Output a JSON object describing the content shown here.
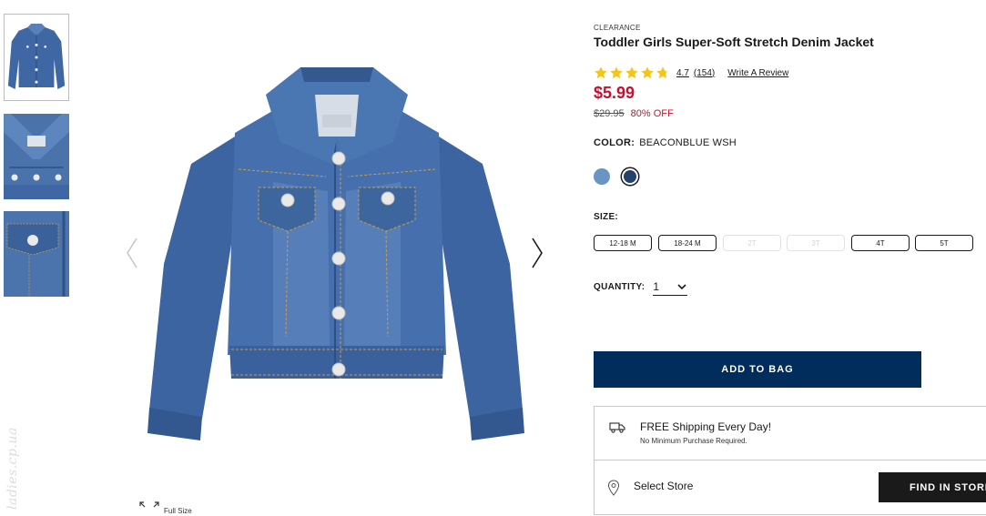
{
  "gallery": {
    "thumbnails": [
      {
        "name": "thumb-jacket-front"
      },
      {
        "name": "thumb-jacket-collar"
      },
      {
        "name": "thumb-jacket-pocket"
      }
    ],
    "full_size_label": "Full Size",
    "watermark": "ladies.cp.ua"
  },
  "product": {
    "eyebrow": "CLEARANCE",
    "title": "Toddler Girls Super-Soft Stretch Denim Jacket",
    "rating": {
      "stars": 4.7,
      "value": "4.7",
      "count": "(154)",
      "write_review": "Write A Review"
    },
    "price": "$5.99",
    "original_price": "$29.95",
    "discount": "80% OFF",
    "color": {
      "label": "COLOR:",
      "value": "BEACONBLUE WSH",
      "swatches": [
        {
          "hex": "#6a94c2",
          "selected": false
        },
        {
          "hex": "#23416b",
          "selected": true
        }
      ]
    },
    "size": {
      "label": "SIZE:",
      "options": [
        {
          "label": "12-18 M",
          "available": true
        },
        {
          "label": "18-24 M",
          "available": true
        },
        {
          "label": "2T",
          "available": false
        },
        {
          "label": "3T",
          "available": false
        },
        {
          "label": "4T",
          "available": true
        },
        {
          "label": "5T",
          "available": true
        }
      ]
    },
    "quantity": {
      "label": "QUANTITY:",
      "value": "1"
    },
    "add_to_bag": "ADD TO BAG",
    "shipping": {
      "title": "FREE Shipping Every Day!",
      "subtitle": "No Minimum Purchase Required."
    },
    "store": {
      "label": "Select Store",
      "button": "FIND IN STORE"
    }
  },
  "colors": {
    "brand_navy": "#002d5c",
    "sale_red": "#c8102e",
    "star_gold": "#f5c518",
    "denim": "#3f67a3"
  }
}
